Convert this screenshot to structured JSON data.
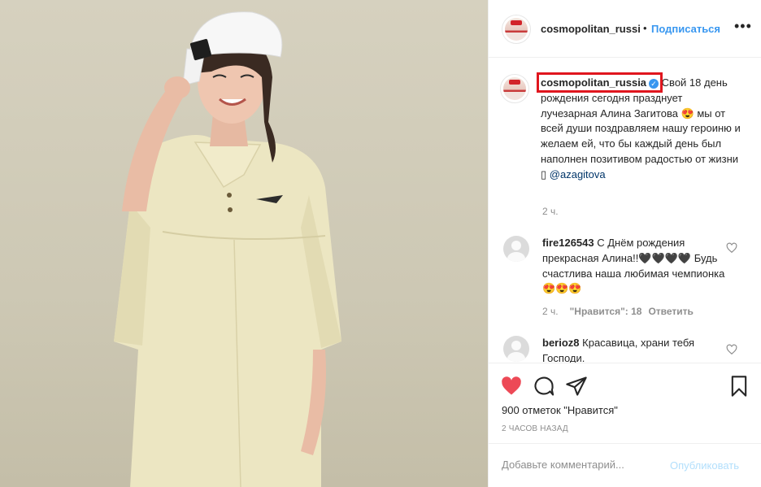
{
  "header": {
    "username": "cosmopolitan_russi",
    "separator": "•",
    "follow_label": "Подписаться",
    "more_label": "•••"
  },
  "caption": {
    "username": "cosmopolitan_russia",
    "verified_mark": "✓",
    "text": "Свой 18 день рождения сегодня празднует лучезарная Алина Загитова 😍 мы от всей души поздравляем нашу героиню и желаем ей, что бы каждый день был наполнен позитивом радостью от жизни ▯",
    "mention": "@azagitova",
    "time": "2 ч."
  },
  "comments": [
    {
      "username": "fire126543",
      "text": "С Днём рождения прекрасная Алина!!🖤🖤🖤🖤 Будь счастлива наша любимая чемпионка😍😍😍",
      "time": "2 ч.",
      "likes": "\"Нравится\": 18",
      "reply": "Ответить"
    },
    {
      "username": "berioz8",
      "text": "Красавица, храни тебя Господи."
    }
  ],
  "actions": {
    "likes_text": "900 отметок \"Нравится\"",
    "posted_ago": "2 ЧАСОВ НАЗАД"
  },
  "add_comment": {
    "placeholder": "Добавьте комментарий...",
    "publish_label": "Опубликовать"
  },
  "colors": {
    "link_blue": "#3897f0",
    "like_red": "#ed4956",
    "highlight_red": "#e0161e"
  },
  "icons": [
    "heart-icon",
    "comment-icon",
    "share-icon",
    "bookmark-icon",
    "verified-icon",
    "more-icon"
  ]
}
